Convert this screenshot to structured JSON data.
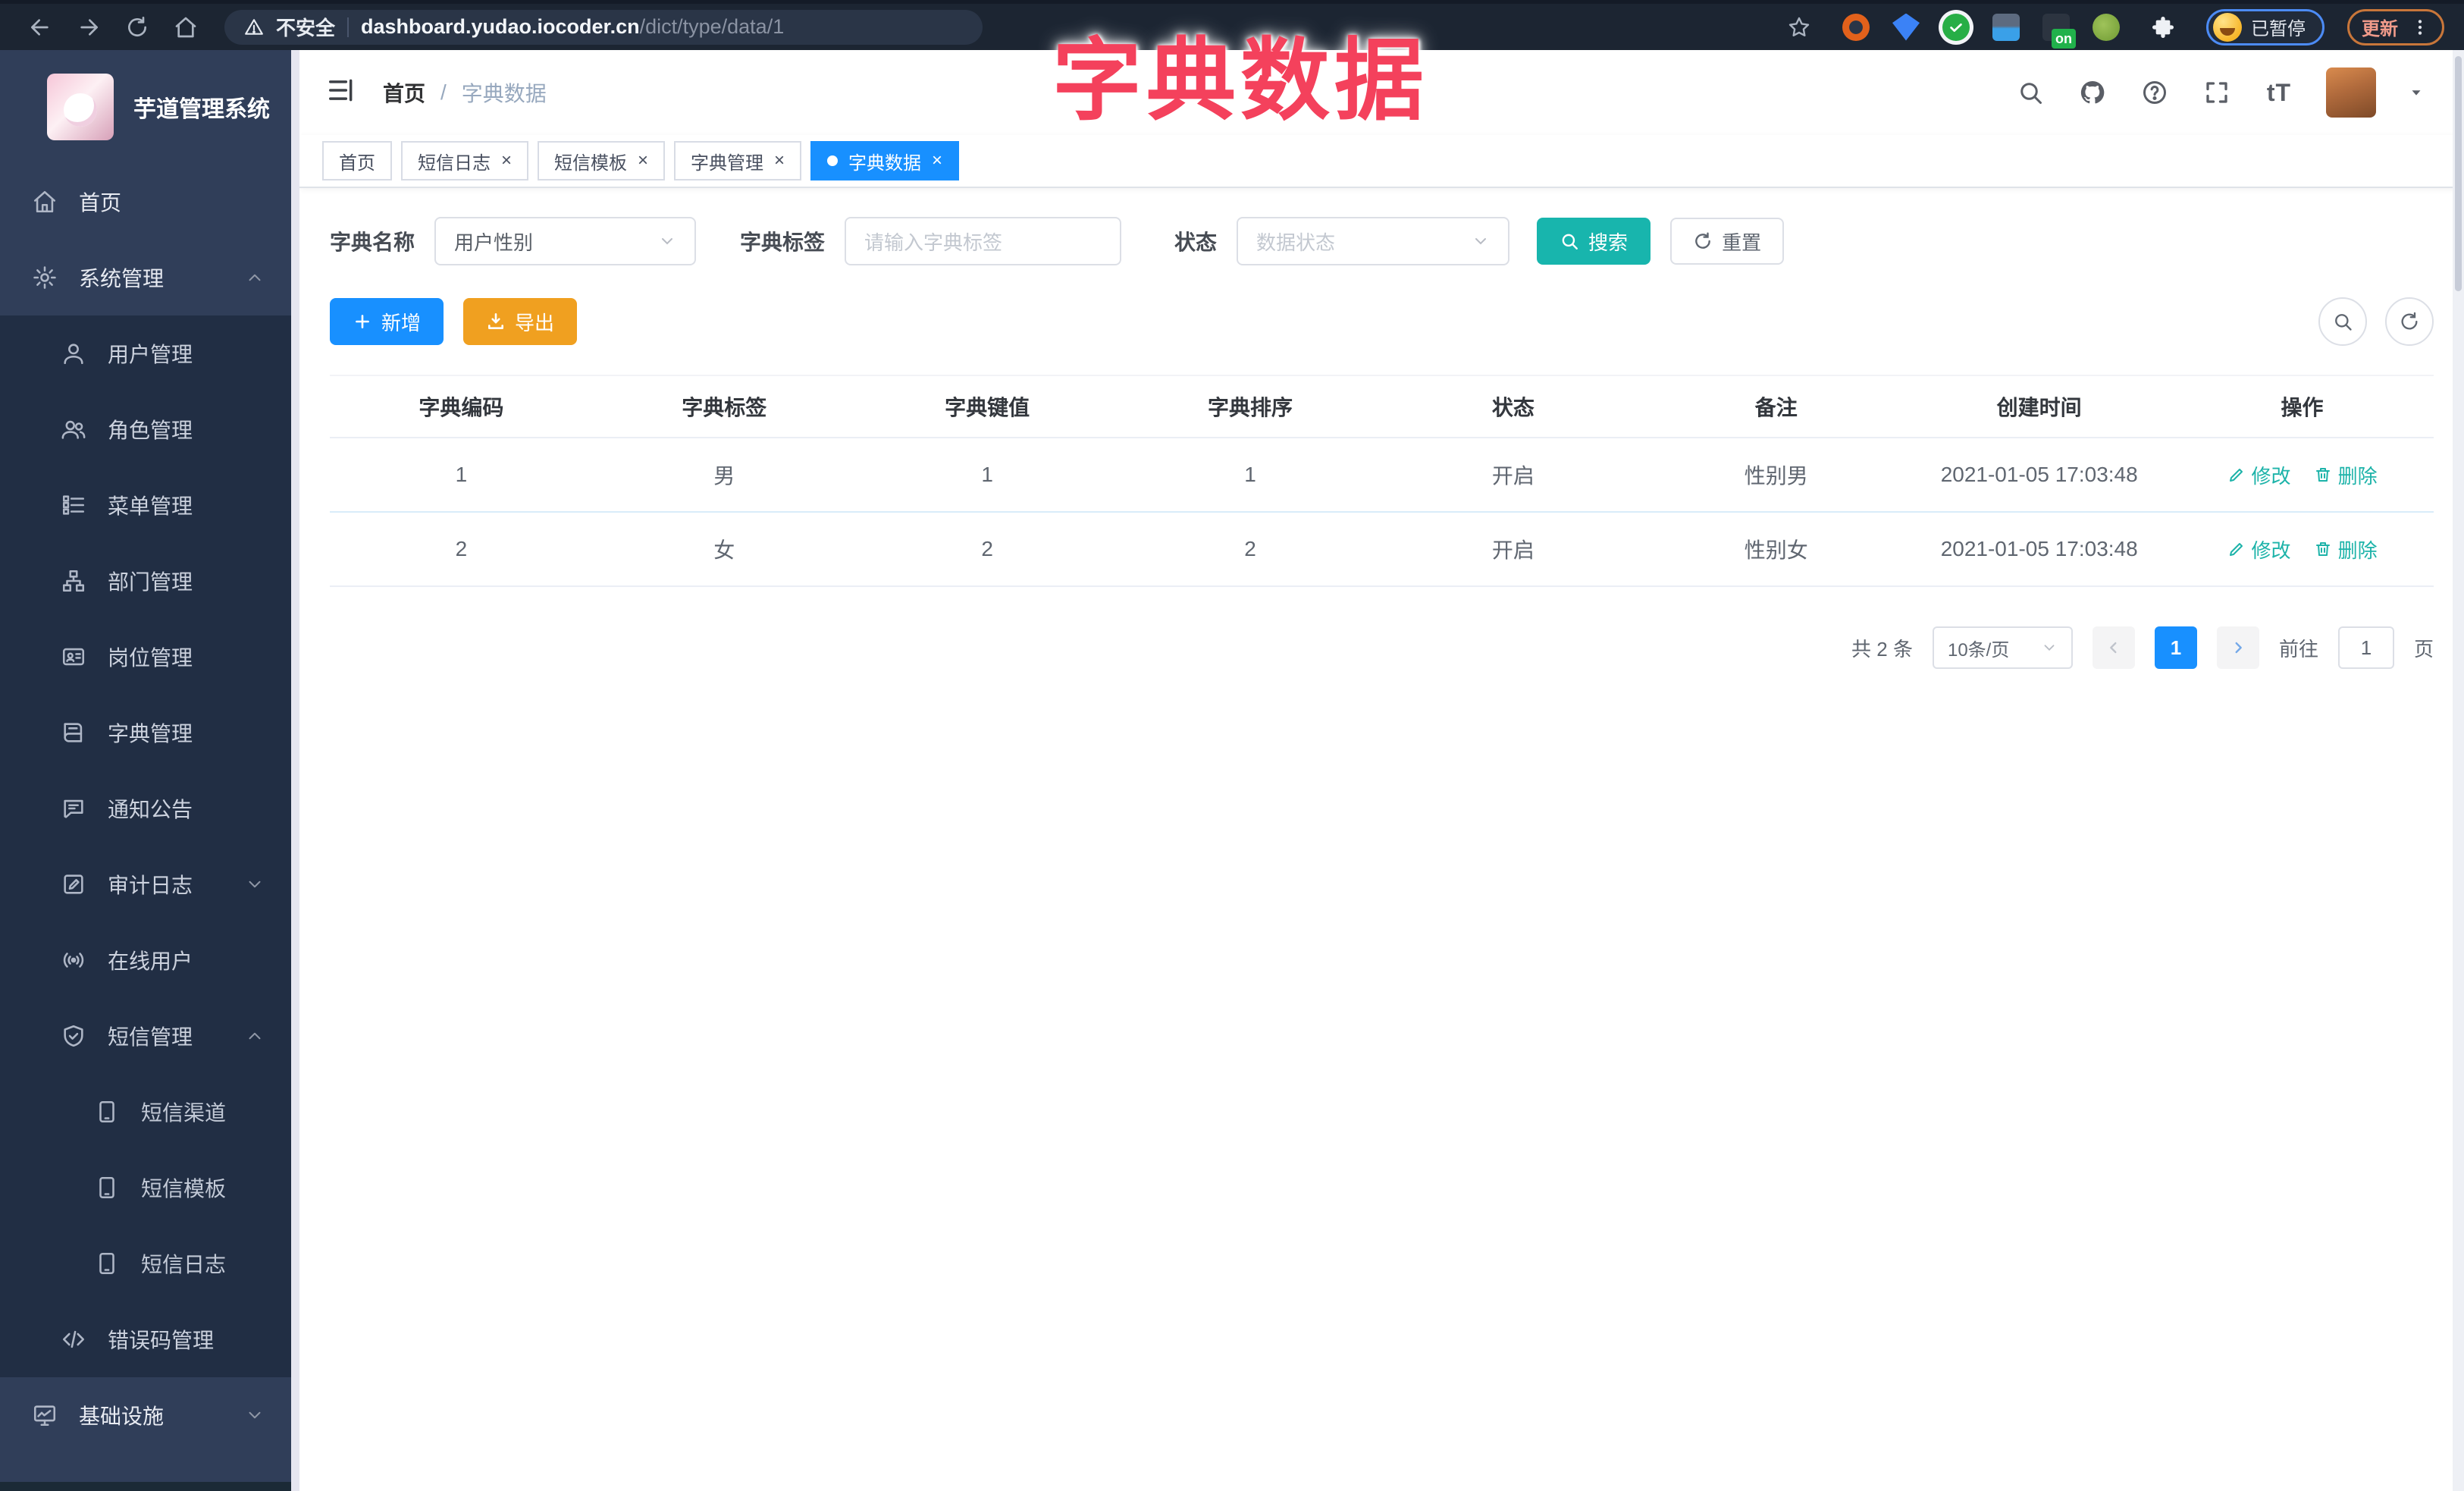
{
  "overlay": {
    "title": "字典数据"
  },
  "browser": {
    "security_label": "不安全",
    "url_domain": "dashboard.yudao.iocoder.cn",
    "url_path": "/dict/type/data/1",
    "extension_on_badge": "on",
    "paused_badge": "已暂停",
    "update_label": "更新"
  },
  "sidebar": {
    "logo_title": "芋道管理系统",
    "items": [
      {
        "label": "首页",
        "icon": "home",
        "level": 0
      },
      {
        "label": "系统管理",
        "icon": "gear",
        "level": 0,
        "chevron": "up"
      },
      {
        "label": "用户管理",
        "icon": "user",
        "level": 1
      },
      {
        "label": "角色管理",
        "icon": "users",
        "level": 1
      },
      {
        "label": "菜单管理",
        "icon": "menu-list",
        "level": 1
      },
      {
        "label": "部门管理",
        "icon": "org-tree",
        "level": 1
      },
      {
        "label": "岗位管理",
        "icon": "badge",
        "level": 1
      },
      {
        "label": "字典管理",
        "icon": "book",
        "level": 1
      },
      {
        "label": "通知公告",
        "icon": "announcement",
        "level": 1
      },
      {
        "label": "审计日志",
        "icon": "audit-log",
        "level": 1,
        "chevron": "down"
      },
      {
        "label": "在线用户",
        "icon": "online",
        "level": 1
      },
      {
        "label": "短信管理",
        "icon": "shield-check",
        "level": 1,
        "chevron": "up"
      },
      {
        "label": "短信渠道",
        "icon": "phone",
        "level": 2
      },
      {
        "label": "短信模板",
        "icon": "phone",
        "level": 2
      },
      {
        "label": "短信日志",
        "icon": "phone",
        "level": 2
      },
      {
        "label": "错误码管理",
        "icon": "code",
        "level": 1
      },
      {
        "label": "基础设施",
        "icon": "monitor",
        "level": 0,
        "chevron": "down"
      }
    ]
  },
  "header": {
    "breadcrumb": [
      "首页",
      "字典数据"
    ],
    "font_icon_text": "tT"
  },
  "tabs": [
    {
      "label": "首页",
      "active": false,
      "closable": false
    },
    {
      "label": "短信日志",
      "active": false,
      "closable": true
    },
    {
      "label": "短信模板",
      "active": false,
      "closable": true
    },
    {
      "label": "字典管理",
      "active": false,
      "closable": true
    },
    {
      "label": "字典数据",
      "active": true,
      "closable": true
    }
  ],
  "filters": {
    "dict_name_label": "字典名称",
    "dict_name_value": "用户性别",
    "dict_label_label": "字典标签",
    "dict_label_placeholder": "请输入字典标签",
    "status_label": "状态",
    "status_placeholder": "数据状态",
    "search_label": "搜索",
    "reset_label": "重置"
  },
  "toolbar": {
    "add_label": "新增",
    "export_label": "导出"
  },
  "table": {
    "columns": [
      "字典编码",
      "字典标签",
      "字典键值",
      "字典排序",
      "状态",
      "备注",
      "创建时间",
      "操作"
    ],
    "rows": [
      {
        "code": "1",
        "label": "男",
        "value": "1",
        "sort": "1",
        "status": "开启",
        "remark": "性别男",
        "created": "2021-01-05 17:03:48"
      },
      {
        "code": "2",
        "label": "女",
        "value": "2",
        "sort": "2",
        "status": "开启",
        "remark": "性别女",
        "created": "2021-01-05 17:03:48"
      }
    ],
    "edit_label": "修改",
    "delete_label": "删除"
  },
  "pagination": {
    "total_text": "共 2 条",
    "page_size_value": "10条/页",
    "current_page": "1",
    "goto_label": "前往",
    "goto_value": "1",
    "page_unit": "页"
  },
  "colors": {
    "accent_blue": "#1890ff",
    "teal": "#18b5ad",
    "amber": "#f0a020",
    "annotation_pink": "#f4415c",
    "sidebar_bg": "#303e59",
    "submenu_bg": "#212e44"
  }
}
